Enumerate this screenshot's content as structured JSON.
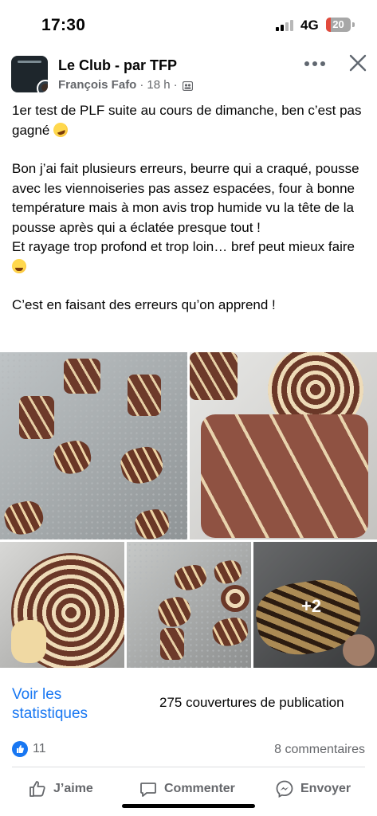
{
  "status_bar": {
    "time": "17:30",
    "network": "4G",
    "battery": "20",
    "battery_level": 0.2,
    "battery_color": "#e24a3c"
  },
  "post": {
    "group_name": "Le Club - par TFP",
    "author": "François Fafo",
    "time_ago": "18 h",
    "separator": "·",
    "audience_icon": "group-members-icon",
    "text_line1": "1er test de PLF suite au cours de dimanche, ben c’est pas gagné",
    "text_paragraph2": "Bon j’ai fait plusieurs erreurs, beurre qui a craqué, pousse avec les viennoiseries pas assez espacées, four à bonne température mais à mon avis trop humide vu la tête de la pousse après qui a éclatée presque tout !\nEt rayage trop profond et trop loin… bref peut mieux faire",
    "text_paragraph3": "C’est en faisant des erreurs qu’on apprend !",
    "extra_photos": "+2"
  },
  "stats": {
    "link": "Voir les statistiques",
    "coverage": "275 couvertures de publication",
    "reaction_count": "11",
    "comments": "8 commentaires"
  },
  "actions": {
    "like": "J’aime",
    "comment": "Commenter",
    "send": "Envoyer"
  },
  "colors": {
    "accent": "#1877f2",
    "secondary_text": "#65676b"
  }
}
